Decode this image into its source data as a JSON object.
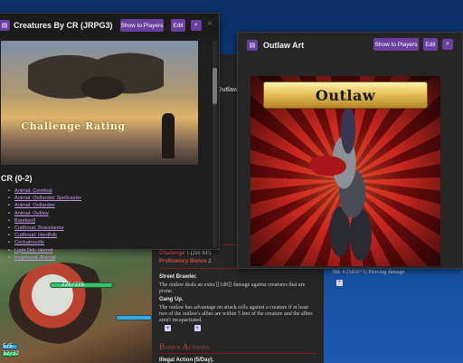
{
  "creatures_window": {
    "title": "Creatures By CR (JRPG3)",
    "show_to_players": "Show to Players",
    "edit": "Edit",
    "hero_caption": "Challenge Rating",
    "heading": "CR (0-2)",
    "items": [
      "Animal: Cerebral",
      "Animal: Outlander Spellcaster",
      "Animal: Outlander",
      "Animal: Outlaw",
      "Bandwolf",
      "Cutthroat: Bracelantor",
      "Cutthroat: Herdfolk",
      "Cockatroodle",
      "Light Orb: Hermit",
      "Innerhood: Animal"
    ]
  },
  "outlaw_window": {
    "title": "Outlaw Art",
    "show_to_players": "Show to Players",
    "edit": "Edit",
    "banner_text": "Outlaw",
    "damage_text": "Hit: 6 (1d10+1) Piercing damage"
  },
  "sheet": {
    "title_fragment": "Outlaw",
    "challenge_label": "Challenge",
    "challenge_value": "1 (200 XP)",
    "prof_label": "Proficiency Bonus",
    "prof_value": "2",
    "street_brawler_title": "Street Brawler.",
    "street_brawler_text": "The outlaw deals an extra [[1d8]] damage against creatures that are prone.",
    "gang_up_title": "Gang Up.",
    "gang_up_text": "The outlaw has advantage on attack rolls against a creature if at least two of the outlaw's allies are within 5 feet of the creature and the allies aren't incapacitated.",
    "bonus_actions_heading": "Bonus Actions",
    "illegal_action": "Illegal Action (5/Day)."
  },
  "tokens": {
    "hp_top": "226/226",
    "hp_left_a": "5/5",
    "hp_left_b": "32/32"
  },
  "colors": {
    "accent_purple": "#6a3fa0",
    "link_purple": "#c89be6",
    "section_red": "#b54545"
  }
}
